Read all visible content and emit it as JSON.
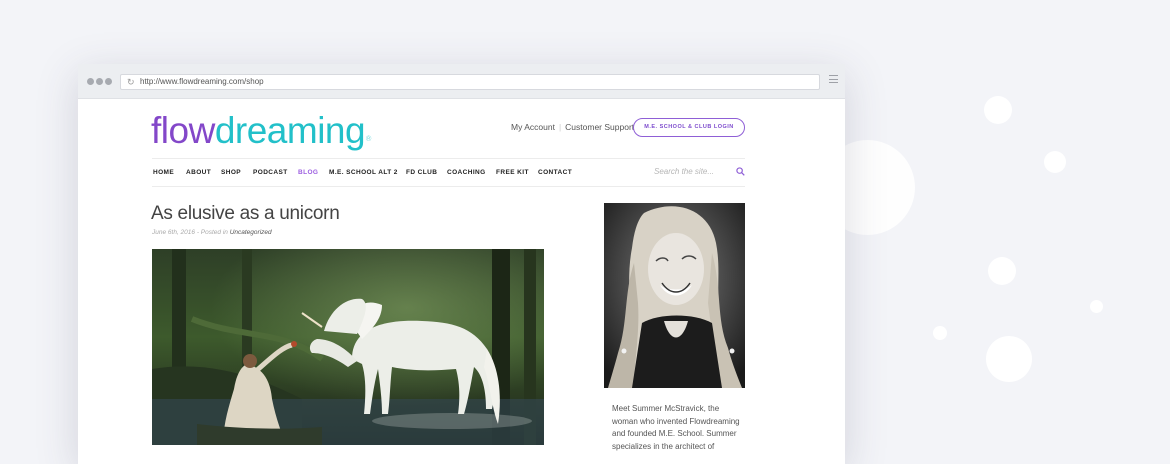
{
  "browser": {
    "url": "http://www.flowdreaming.com/shop"
  },
  "header": {
    "logo_part1": "flow",
    "logo_part2": "dreaming",
    "logo_mark": "®",
    "my_account": "My Account",
    "customer_support": "Customer Support",
    "login_button": "M.E. SCHOOL & CLUB LOGIN"
  },
  "nav": {
    "items": [
      {
        "label": "HOME"
      },
      {
        "label": "ABOUT"
      },
      {
        "label": "SHOP"
      },
      {
        "label": "PODCAST"
      },
      {
        "label": "BLOG"
      },
      {
        "label": "M.E. SCHOOL ALT 2"
      },
      {
        "label": "FD CLUB"
      },
      {
        "label": "COACHING"
      },
      {
        "label": "FREE KIT"
      },
      {
        "label": "CONTACT"
      }
    ],
    "active_item": "BLOG",
    "search_placeholder": "Search the site..."
  },
  "post": {
    "title": "As elusive as a unicorn",
    "meta_prefix": "June 6th, 2016 - Posted in ",
    "category": "Uncategorized"
  },
  "sidebar": {
    "bio_text": "Meet Summer McStravick, the woman who invented Flowdreaming and founded M.E. School. Summer specializes in the architect of"
  },
  "colors": {
    "brand_purple": "#8347c9",
    "brand_teal": "#22c0c9",
    "nav_active": "#9c5fe0"
  }
}
